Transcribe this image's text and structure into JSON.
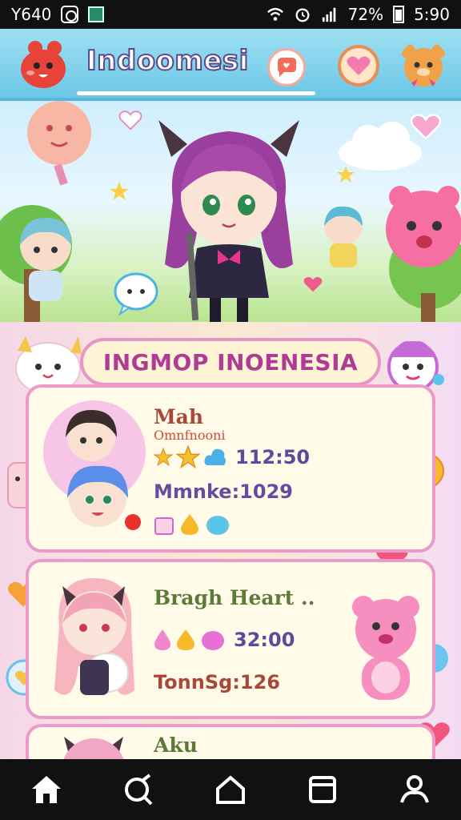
{
  "status_bar": {
    "left_text": "Y640",
    "battery": "72%",
    "time": "5:90"
  },
  "header": {
    "title": "Indoomesi"
  },
  "panel": {
    "banner_title": "INGMOP INOENESIA"
  },
  "cards": [
    {
      "name": "Mah",
      "subtitle": "Omnfnooni",
      "time_value": "112:50",
      "stat_line": "Mmnke:1029"
    },
    {
      "name": "Bragh Heart ..",
      "time_value": "32:00",
      "stat_line": "TonnSg:126"
    },
    {
      "name": "Aku"
    }
  ],
  "colors": {
    "header_bg": "#6bc7e6",
    "accent_pink": "#eb9acb",
    "banner_text": "#b03b94",
    "nav_bg": "#111111"
  },
  "nav": [
    "home-icon",
    "search-icon",
    "house-icon",
    "inbox-icon",
    "profile-icon"
  ]
}
